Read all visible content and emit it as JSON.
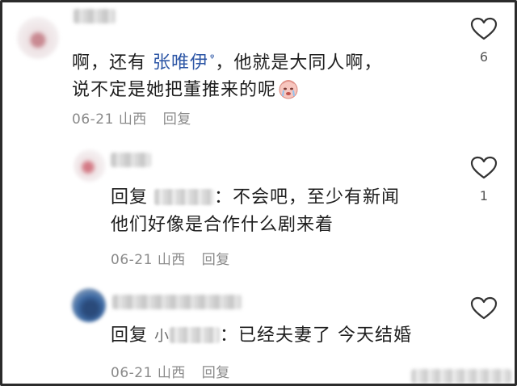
{
  "comments": [
    {
      "text_before": "啊，还有 ",
      "mention": "张唯伊",
      "text_after": "，他就是大同人啊，",
      "text_line2": "说不定是她把董推来的呢",
      "emoji": "crying-face-emoji",
      "date": "06-21",
      "location": "山西",
      "reply_label": "回复",
      "like_count": "6"
    },
    {
      "prefix": "回复",
      "text_after": "：不会吧，至少有新闻",
      "text_line2": "他们好像是合作什么剧来着",
      "date": "06-21",
      "location": "山西",
      "reply_label": "回复",
      "like_count": "1"
    },
    {
      "prefix": "回复",
      "blur_prefix": "小",
      "text_after": "：已经夫妻了 今天结婚",
      "date": "06-21",
      "location": "山西",
      "reply_label": "回复",
      "like_count": ""
    }
  ],
  "icons": {
    "like": "heart-outline-icon",
    "mention": "search-mention-icon"
  },
  "colors": {
    "mention": "#2e57a6",
    "meta": "#8a8a8a",
    "text": "#1e1e1e"
  }
}
